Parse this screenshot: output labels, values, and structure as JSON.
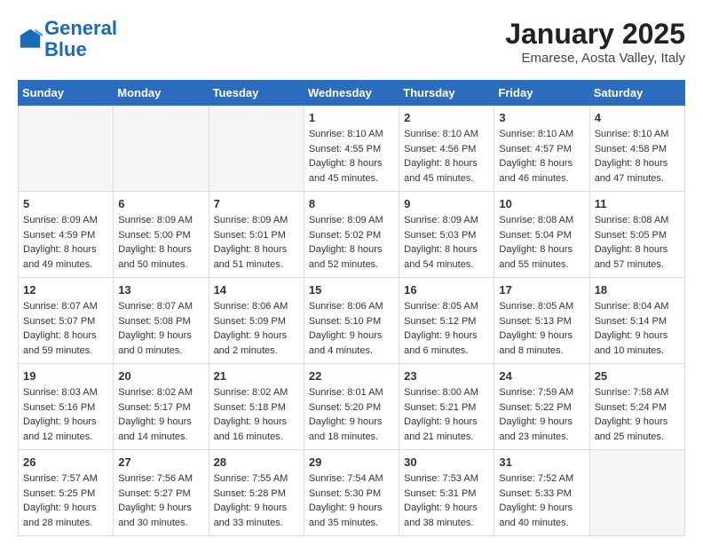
{
  "header": {
    "logo_line1": "General",
    "logo_line2": "Blue",
    "month_year": "January 2025",
    "location": "Emarese, Aosta Valley, Italy"
  },
  "calendar": {
    "days_of_week": [
      "Sunday",
      "Monday",
      "Tuesday",
      "Wednesday",
      "Thursday",
      "Friday",
      "Saturday"
    ],
    "weeks": [
      [
        {
          "day": "",
          "info": ""
        },
        {
          "day": "",
          "info": ""
        },
        {
          "day": "",
          "info": ""
        },
        {
          "day": "1",
          "info": "Sunrise: 8:10 AM\nSunset: 4:55 PM\nDaylight: 8 hours\nand 45 minutes."
        },
        {
          "day": "2",
          "info": "Sunrise: 8:10 AM\nSunset: 4:56 PM\nDaylight: 8 hours\nand 45 minutes."
        },
        {
          "day": "3",
          "info": "Sunrise: 8:10 AM\nSunset: 4:57 PM\nDaylight: 8 hours\nand 46 minutes."
        },
        {
          "day": "4",
          "info": "Sunrise: 8:10 AM\nSunset: 4:58 PM\nDaylight: 8 hours\nand 47 minutes."
        }
      ],
      [
        {
          "day": "5",
          "info": "Sunrise: 8:09 AM\nSunset: 4:59 PM\nDaylight: 8 hours\nand 49 minutes."
        },
        {
          "day": "6",
          "info": "Sunrise: 8:09 AM\nSunset: 5:00 PM\nDaylight: 8 hours\nand 50 minutes."
        },
        {
          "day": "7",
          "info": "Sunrise: 8:09 AM\nSunset: 5:01 PM\nDaylight: 8 hours\nand 51 minutes."
        },
        {
          "day": "8",
          "info": "Sunrise: 8:09 AM\nSunset: 5:02 PM\nDaylight: 8 hours\nand 52 minutes."
        },
        {
          "day": "9",
          "info": "Sunrise: 8:09 AM\nSunset: 5:03 PM\nDaylight: 8 hours\nand 54 minutes."
        },
        {
          "day": "10",
          "info": "Sunrise: 8:08 AM\nSunset: 5:04 PM\nDaylight: 8 hours\nand 55 minutes."
        },
        {
          "day": "11",
          "info": "Sunrise: 8:08 AM\nSunset: 5:05 PM\nDaylight: 8 hours\nand 57 minutes."
        }
      ],
      [
        {
          "day": "12",
          "info": "Sunrise: 8:07 AM\nSunset: 5:07 PM\nDaylight: 8 hours\nand 59 minutes."
        },
        {
          "day": "13",
          "info": "Sunrise: 8:07 AM\nSunset: 5:08 PM\nDaylight: 9 hours\nand 0 minutes."
        },
        {
          "day": "14",
          "info": "Sunrise: 8:06 AM\nSunset: 5:09 PM\nDaylight: 9 hours\nand 2 minutes."
        },
        {
          "day": "15",
          "info": "Sunrise: 8:06 AM\nSunset: 5:10 PM\nDaylight: 9 hours\nand 4 minutes."
        },
        {
          "day": "16",
          "info": "Sunrise: 8:05 AM\nSunset: 5:12 PM\nDaylight: 9 hours\nand 6 minutes."
        },
        {
          "day": "17",
          "info": "Sunrise: 8:05 AM\nSunset: 5:13 PM\nDaylight: 9 hours\nand 8 minutes."
        },
        {
          "day": "18",
          "info": "Sunrise: 8:04 AM\nSunset: 5:14 PM\nDaylight: 9 hours\nand 10 minutes."
        }
      ],
      [
        {
          "day": "19",
          "info": "Sunrise: 8:03 AM\nSunset: 5:16 PM\nDaylight: 9 hours\nand 12 minutes."
        },
        {
          "day": "20",
          "info": "Sunrise: 8:02 AM\nSunset: 5:17 PM\nDaylight: 9 hours\nand 14 minutes."
        },
        {
          "day": "21",
          "info": "Sunrise: 8:02 AM\nSunset: 5:18 PM\nDaylight: 9 hours\nand 16 minutes."
        },
        {
          "day": "22",
          "info": "Sunrise: 8:01 AM\nSunset: 5:20 PM\nDaylight: 9 hours\nand 18 minutes."
        },
        {
          "day": "23",
          "info": "Sunrise: 8:00 AM\nSunset: 5:21 PM\nDaylight: 9 hours\nand 21 minutes."
        },
        {
          "day": "24",
          "info": "Sunrise: 7:59 AM\nSunset: 5:22 PM\nDaylight: 9 hours\nand 23 minutes."
        },
        {
          "day": "25",
          "info": "Sunrise: 7:58 AM\nSunset: 5:24 PM\nDaylight: 9 hours\nand 25 minutes."
        }
      ],
      [
        {
          "day": "26",
          "info": "Sunrise: 7:57 AM\nSunset: 5:25 PM\nDaylight: 9 hours\nand 28 minutes."
        },
        {
          "day": "27",
          "info": "Sunrise: 7:56 AM\nSunset: 5:27 PM\nDaylight: 9 hours\nand 30 minutes."
        },
        {
          "day": "28",
          "info": "Sunrise: 7:55 AM\nSunset: 5:28 PM\nDaylight: 9 hours\nand 33 minutes."
        },
        {
          "day": "29",
          "info": "Sunrise: 7:54 AM\nSunset: 5:30 PM\nDaylight: 9 hours\nand 35 minutes."
        },
        {
          "day": "30",
          "info": "Sunrise: 7:53 AM\nSunset: 5:31 PM\nDaylight: 9 hours\nand 38 minutes."
        },
        {
          "day": "31",
          "info": "Sunrise: 7:52 AM\nSunset: 5:33 PM\nDaylight: 9 hours\nand 40 minutes."
        },
        {
          "day": "",
          "info": ""
        }
      ]
    ]
  }
}
